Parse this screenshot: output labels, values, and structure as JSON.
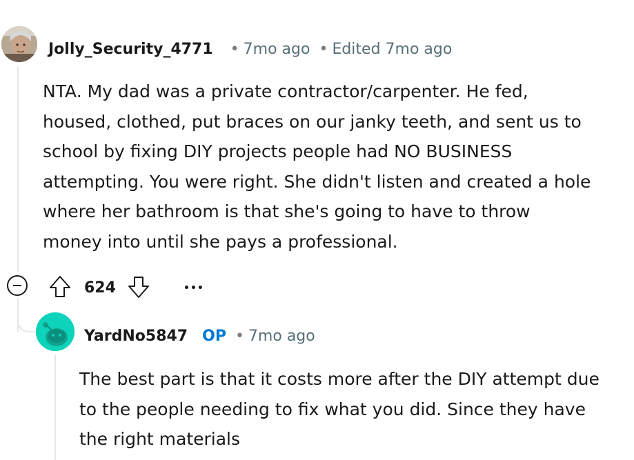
{
  "comment": {
    "username": "Jolly_Security_4771",
    "time": "7mo ago",
    "edited": "Edited 7mo ago",
    "separator": "•",
    "body": "NTA. My dad was a private contractor/carpenter. He fed,\nhoused, clothed, put braces on our janky teeth, and sent us to\nschool by fixing DIY projects people had NO BUSINESS\nattempting. You were right. She didn't listen and created a hole\nwhere her bathroom is that she's going to have to throw\nmoney into until she pays a professional.",
    "votes": "624",
    "more_label": "•••"
  },
  "reply": {
    "username": "YardNo5847",
    "badge": "OP",
    "time": "7mo ago",
    "separator": "•",
    "body": "The best part is that it costs more after the DIY attempt due\nto the people needing to fix what you did. Since they have\nthe right materials"
  },
  "colors": {
    "op_badge": "#0079d3",
    "reply_avatar": "#0dd3bb",
    "thread_line": "#e5e7ea"
  }
}
